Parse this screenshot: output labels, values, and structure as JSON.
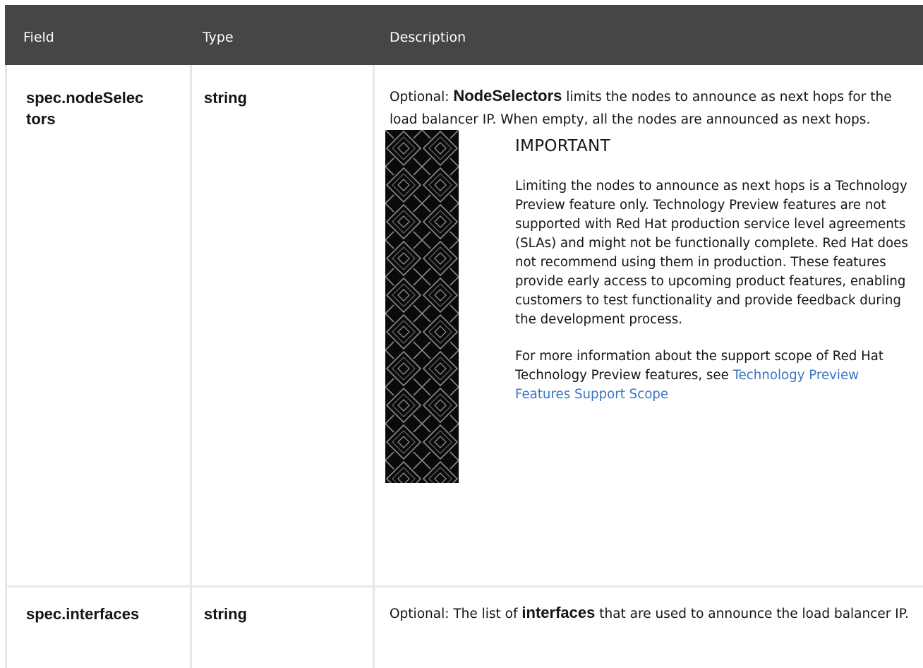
{
  "header": {
    "field": "Field",
    "type": "Type",
    "description": "Description"
  },
  "rows": [
    {
      "field_line1": "spec.nodeSelec",
      "field_line2": "tors",
      "type": "string",
      "desc_prefix": "Optional: ",
      "desc_bold": "NodeSelectors",
      "desc_suffix": " limits the nodes to announce as next hops for the load balancer IP. When empty, all the nodes are announced as next hops.",
      "admonition": {
        "title": "IMPORTANT",
        "icon": "red-hat-pattern",
        "paragraph1": "Limiting the nodes to announce as next hops is a Technology Preview feature only. Technology Preview features are not supported with Red Hat production service level agreements (SLAs) and might not be functionally complete. Red Hat does not recommend using them in production. These features provide early access to upcoming product features, enabling customers to test functionality and provide feedback during the development process.",
        "paragraph2": "For more information about the support scope of Red Hat Technology Preview features, see ",
        "link_text": "Technology Preview Features Support Scope",
        "link_color": "#3a74c4"
      }
    },
    {
      "field": "spec.interfaces",
      "type": "string",
      "desc_prefix": "Optional: The list of ",
      "desc_bold": "interfaces",
      "desc_suffix": " that are used to announce the load balancer IP."
    }
  ],
  "colors": {
    "header_bg": "#464646",
    "header_text": "#ffffff",
    "border": "#e7e7e7"
  }
}
